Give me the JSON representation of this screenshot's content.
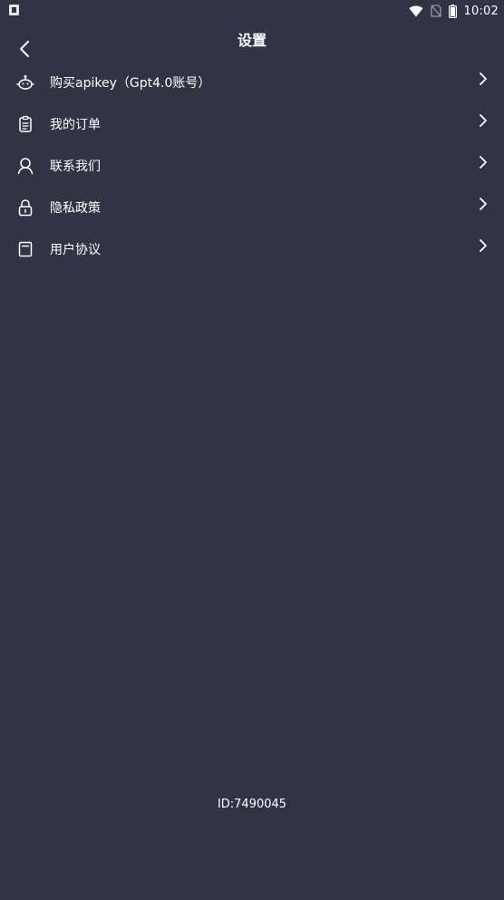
{
  "status_bar": {
    "time": "10:02",
    "icons": [
      "app-notification-icon",
      "wifi-icon",
      "no-sim-icon",
      "battery-icon"
    ]
  },
  "header": {
    "title": "设置",
    "back_icon": "chevron-left-icon"
  },
  "menu": {
    "items": [
      {
        "label": "购买apikey（Gpt4.0账号）",
        "icon": "robot-icon"
      },
      {
        "label": "我的订单",
        "icon": "clipboard-icon"
      },
      {
        "label": "联系我们",
        "icon": "user-icon"
      },
      {
        "label": "隐私政策",
        "icon": "lock-icon"
      },
      {
        "label": "用户协议",
        "icon": "document-icon"
      }
    ],
    "chevron_icon": "chevron-right-icon"
  },
  "footer": {
    "id_text": "ID:7490045"
  },
  "colors": {
    "background": "#323445",
    "text": "#ffffff"
  }
}
